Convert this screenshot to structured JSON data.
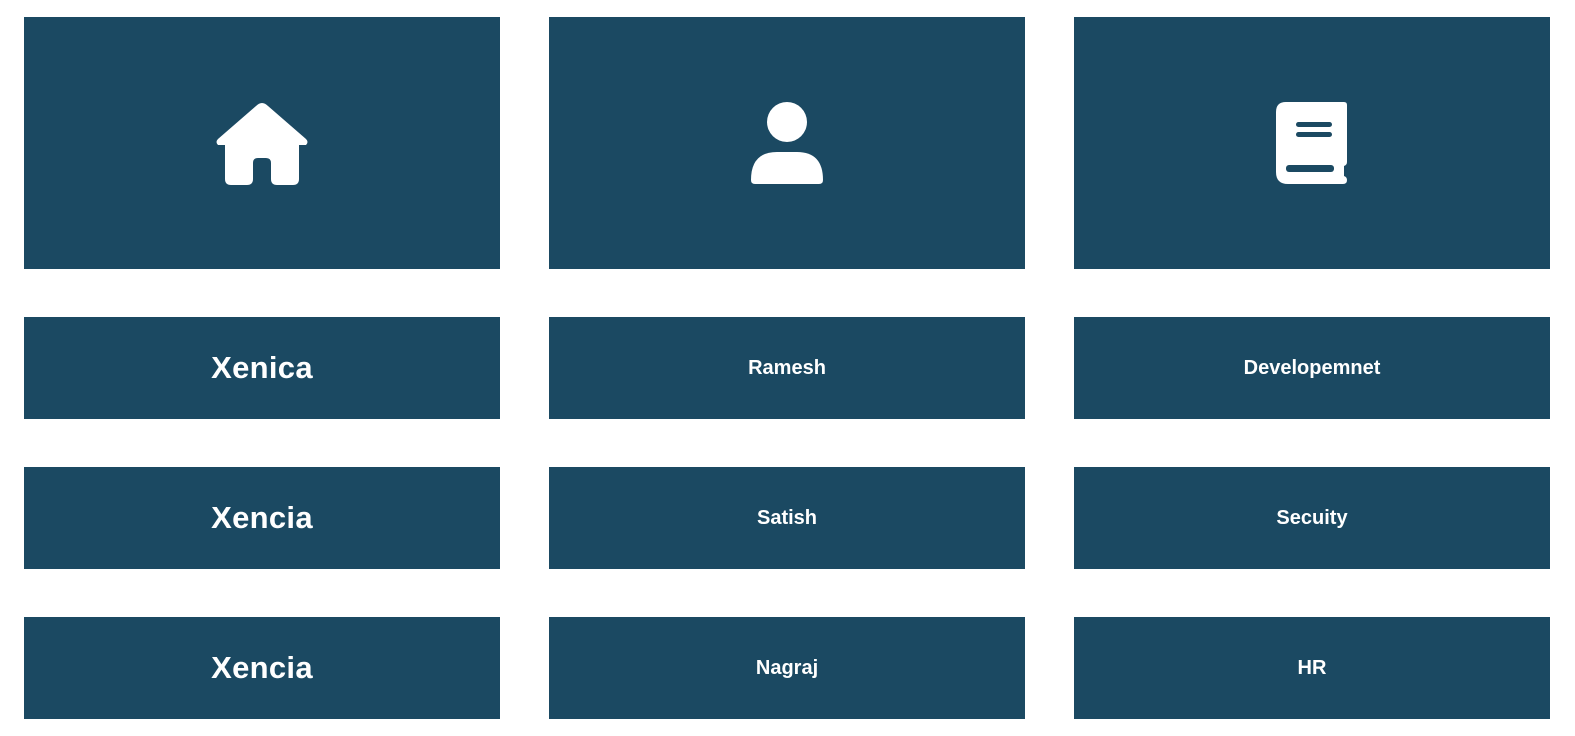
{
  "theme": {
    "tile_color": "#1b4962",
    "text_color": "#ffffff",
    "background": "#ffffff"
  },
  "icons": [
    {
      "name": "home-icon"
    },
    {
      "name": "user-icon"
    },
    {
      "name": "book-icon"
    }
  ],
  "columns": {
    "company": [
      "Xenica",
      "Xencia",
      "Xencia"
    ],
    "person": [
      "Ramesh",
      "Satish",
      "Nagraj"
    ],
    "department": [
      "Developemnet",
      "Secuity",
      "HR"
    ]
  }
}
